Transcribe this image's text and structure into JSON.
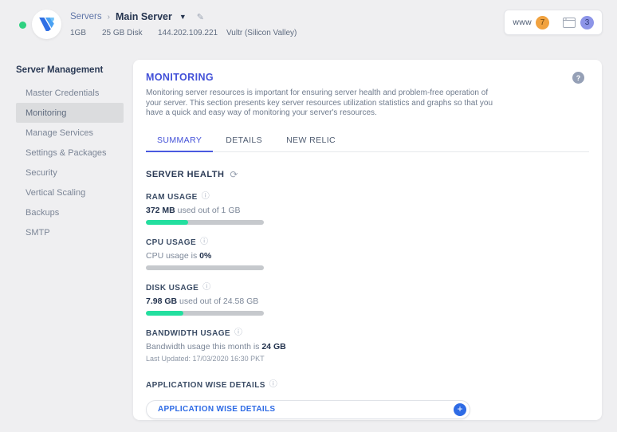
{
  "colors": {
    "accent_indigo": "#4351d8",
    "link_blue": "#2e6be5",
    "progress_green": "#23df9f",
    "progress_track": "#c6c9cd",
    "status_green": "#2fd181",
    "badge_orange": "#f1a23f",
    "badge_purple": "#8d95e8",
    "page_background": "#efeff1"
  },
  "header": {
    "breadcrumb": {
      "root": "Servers",
      "separator": "›",
      "current": "Main Server"
    },
    "specs": [
      "1GB",
      "25 GB Disk",
      "144.202.109.221",
      "Vultr (Silicon Valley)"
    ],
    "badges": {
      "www_label": "www",
      "apps_count": "7",
      "projects_count": "3"
    }
  },
  "sidebar": {
    "title": "Server Management",
    "items": [
      {
        "label": "Master Credentials",
        "active": false
      },
      {
        "label": "Monitoring",
        "active": true
      },
      {
        "label": "Manage Services",
        "active": false
      },
      {
        "label": "Settings & Packages",
        "active": false
      },
      {
        "label": "Security",
        "active": false
      },
      {
        "label": "Vertical Scaling",
        "active": false
      },
      {
        "label": "Backups",
        "active": false
      },
      {
        "label": "SMTP",
        "active": false
      }
    ]
  },
  "main": {
    "title": "MONITORING",
    "description_lines": [
      "Monitoring server resources is important for ensuring server health and problem-free operation of",
      "your server. This section presents key server resources utilization statistics and graphs so that you",
      "have a quick and easy way of monitoring your server's resources."
    ],
    "tabs": [
      {
        "label": "SUMMARY",
        "active": true
      },
      {
        "label": "DETAILS",
        "active": false
      },
      {
        "label": "NEW RELIC",
        "active": false
      }
    ],
    "server_health": {
      "title": "SERVER HEALTH",
      "metrics": [
        {
          "name": "RAM USAGE",
          "prefix": "",
          "value": "372 MB",
          "suffix": " used out of 1 GB",
          "percent": 36
        },
        {
          "name": "CPU USAGE",
          "prefix": "CPU usage is ",
          "value": "0%",
          "suffix": "",
          "percent": 0
        },
        {
          "name": "DISK USAGE",
          "prefix": "",
          "value": "7.98 GB",
          "suffix": " used out of 24.58 GB",
          "percent": 32
        },
        {
          "name": "BANDWIDTH USAGE",
          "prefix": "Bandwidth usage this month is ",
          "value": "24 GB",
          "suffix": "",
          "note": "Last Updated: 17/03/2020 16:30 PKT"
        }
      ]
    },
    "app_details": {
      "heading": "APPLICATION WISE DETAILS",
      "button_label": "APPLICATION WISE DETAILS",
      "expand_icon": "+"
    }
  }
}
